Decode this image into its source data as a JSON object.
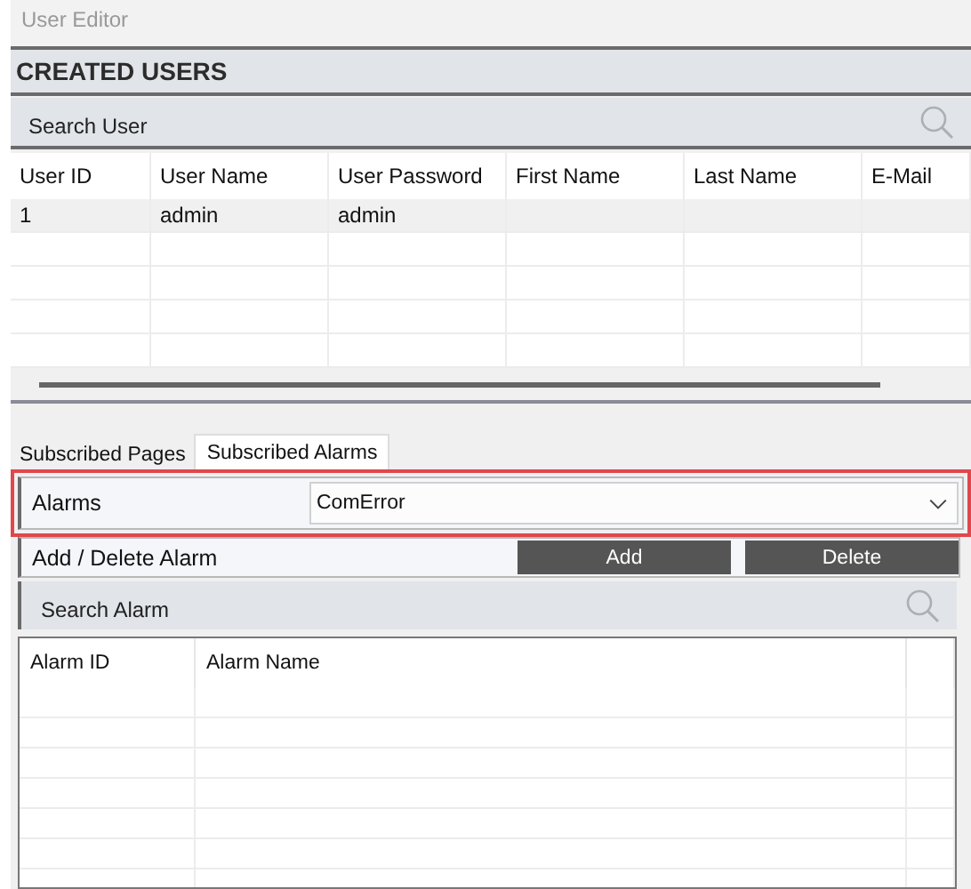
{
  "window": {
    "title": "User Editor"
  },
  "created_users": {
    "heading": "CREATED USERS",
    "search": {
      "placeholder": "Search User"
    },
    "table": {
      "columns": [
        "User ID",
        "User Name",
        "User Password",
        "First Name",
        "Last Name",
        "E-Mail"
      ],
      "rows": [
        [
          "1",
          "admin",
          "admin",
          "",
          "",
          ""
        ]
      ]
    }
  },
  "tabs": [
    {
      "label": "Subscribed Pages",
      "selected": false
    },
    {
      "label": "Subscribed Alarms",
      "selected": true
    }
  ],
  "alarm_selector": {
    "label": "Alarms",
    "value": "ComError",
    "highlighted": true
  },
  "add_delete": {
    "label": "Add / Delete Alarm",
    "buttons": [
      "Add",
      "Delete"
    ]
  },
  "alarm_search": {
    "placeholder": "Search Alarm"
  },
  "alarm_table": {
    "columns": [
      "Alarm ID",
      "Alarm Name"
    ]
  }
}
